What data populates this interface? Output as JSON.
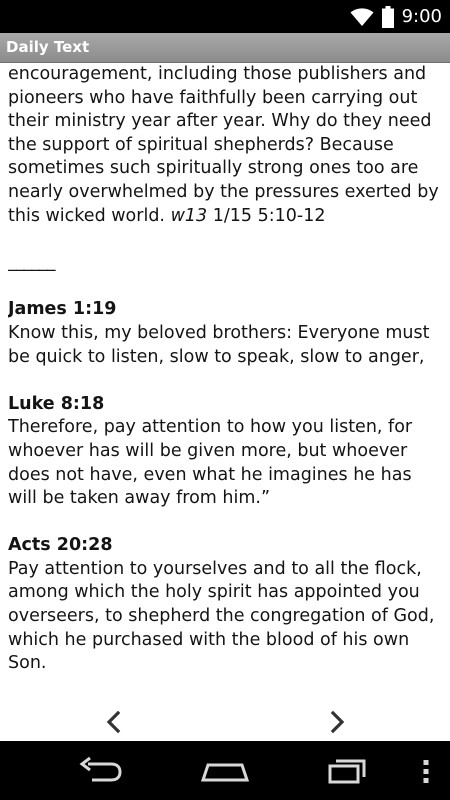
{
  "status": {
    "time": "9:00",
    "wifi_icon": "wifi-icon",
    "battery_icon": "battery-icon"
  },
  "header": {
    "title": "Daily Text"
  },
  "main": {
    "intro_lines": [
      "encouragement, including those publishers and",
      "pioneers who have faithfully been carrying out",
      "their ministry year after year. Why do they need",
      "the support of spiritual shepherds? Because",
      "sometimes such spiritually strong ones too are",
      "nearly overwhelmed by the pressures exerted by",
      "this wicked world. "
    ],
    "source_italic": "w13",
    "source_rest": " 1/15 5:10-12",
    "divider": "______",
    "verses": [
      {
        "ref": "James 1:19",
        "text": "Know this, my beloved brothers: Everyone must be quick to listen, slow to speak, slow to anger,"
      },
      {
        "ref": "Luke 8:18",
        "text": "Therefore, pay attention to how you listen, for whoever has will be given more, but whoever does not have, even what he imagines he has will be taken away from him.”"
      },
      {
        "ref": "Acts 20:28",
        "text": "Pay attention to yourselves and to all the flock, among which the holy spirit has appointed you overseers, to shepherd the congregation of God, which he purchased with the blood of his own Son."
      }
    ]
  },
  "navigation": {
    "prev_icon": "chevron-left-icon",
    "next_icon": "chevron-right-icon"
  },
  "system_nav": {
    "back_icon": "back-icon",
    "home_icon": "home-icon",
    "recent_icon": "recent-apps-icon",
    "menu_icon": "overflow-menu-icon"
  }
}
